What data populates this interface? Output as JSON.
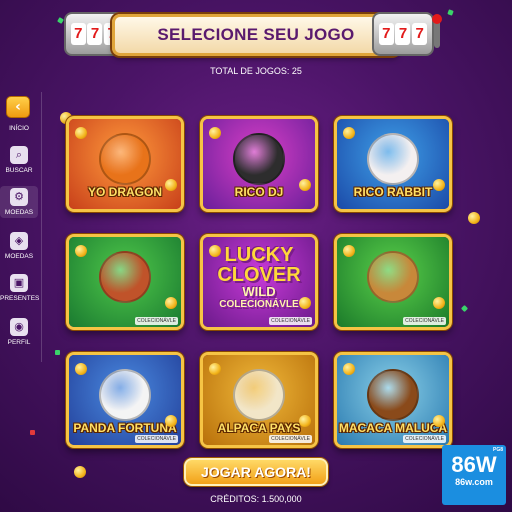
{
  "header": {
    "title": "SELECIONE SEU JOGO",
    "slot_digits": [
      "7",
      "7",
      "7"
    ],
    "total_label": "TOTAL DE JOGOS: 25"
  },
  "sidebar": {
    "back_icon": "chevron-left-icon",
    "items": [
      {
        "label": "INÍCIO",
        "icon": "home-icon"
      },
      {
        "label": "BUSCAR",
        "icon": "search-icon"
      },
      {
        "label": "MOEDAS",
        "icon": "coins-gear-icon",
        "active": true
      },
      {
        "label": "MOEDAS",
        "icon": "coins-tag-icon"
      },
      {
        "label": "PRESENTES",
        "icon": "gift-icon"
      },
      {
        "label": "PERFIL",
        "icon": "profile-icon"
      }
    ]
  },
  "games": [
    {
      "name": "YO DRAGON",
      "tag": "",
      "colors": [
        "#ff9a3c",
        "#c8401a"
      ],
      "mascot": "#e8731a"
    },
    {
      "name": "RICO DJ",
      "tag": "",
      "colors": [
        "#d93fc7",
        "#6a1f9a"
      ],
      "mascot": "#2d2d2d"
    },
    {
      "name": "RICO RABBIT",
      "tag": "",
      "colors": [
        "#3fa0e8",
        "#1b4aa8"
      ],
      "mascot": "#f4f0f0"
    },
    {
      "name": "",
      "tag": "COLECIONÁVLE",
      "colors": [
        "#4fc84a",
        "#1a7a30"
      ],
      "mascot": "#c0532a"
    },
    {
      "name": "",
      "tag": "COLECIONÁVLE",
      "colors": [
        "#c83ad8",
        "#6a1a8a"
      ],
      "mascot": "",
      "big_lines": [
        "LUCKY",
        "CLOVER"
      ],
      "sub_lines": [
        "WILD",
        "COLECIONÁVLE"
      ]
    },
    {
      "name": "",
      "tag": "COLECIONÁVLE",
      "colors": [
        "#5ad04a",
        "#1b7a2a"
      ],
      "mascot": "#c8883a"
    },
    {
      "name": "PANDA FORTUNA",
      "tag": "COLECIONÁVLE",
      "colors": [
        "#4a8ae0",
        "#23409a"
      ],
      "mascot": "#f4f4f4"
    },
    {
      "name": "ALPACA PAYS",
      "tag": "COLECIONÁVLE",
      "colors": [
        "#f0b83a",
        "#b8700a"
      ],
      "mascot": "#f2e6c8"
    },
    {
      "name": "MACACA MALUCA",
      "tag": "COLECIONÁVLE",
      "colors": [
        "#8ad0e8",
        "#2a7ab0"
      ],
      "mascot": "#8a4a1a"
    }
  ],
  "cta": {
    "label": "JOGAR AGORA!",
    "credits": "CRÉDITOS: 1.500,000"
  },
  "watermark": {
    "top": "PG8",
    "big": "86W",
    "small": "86w.com"
  }
}
